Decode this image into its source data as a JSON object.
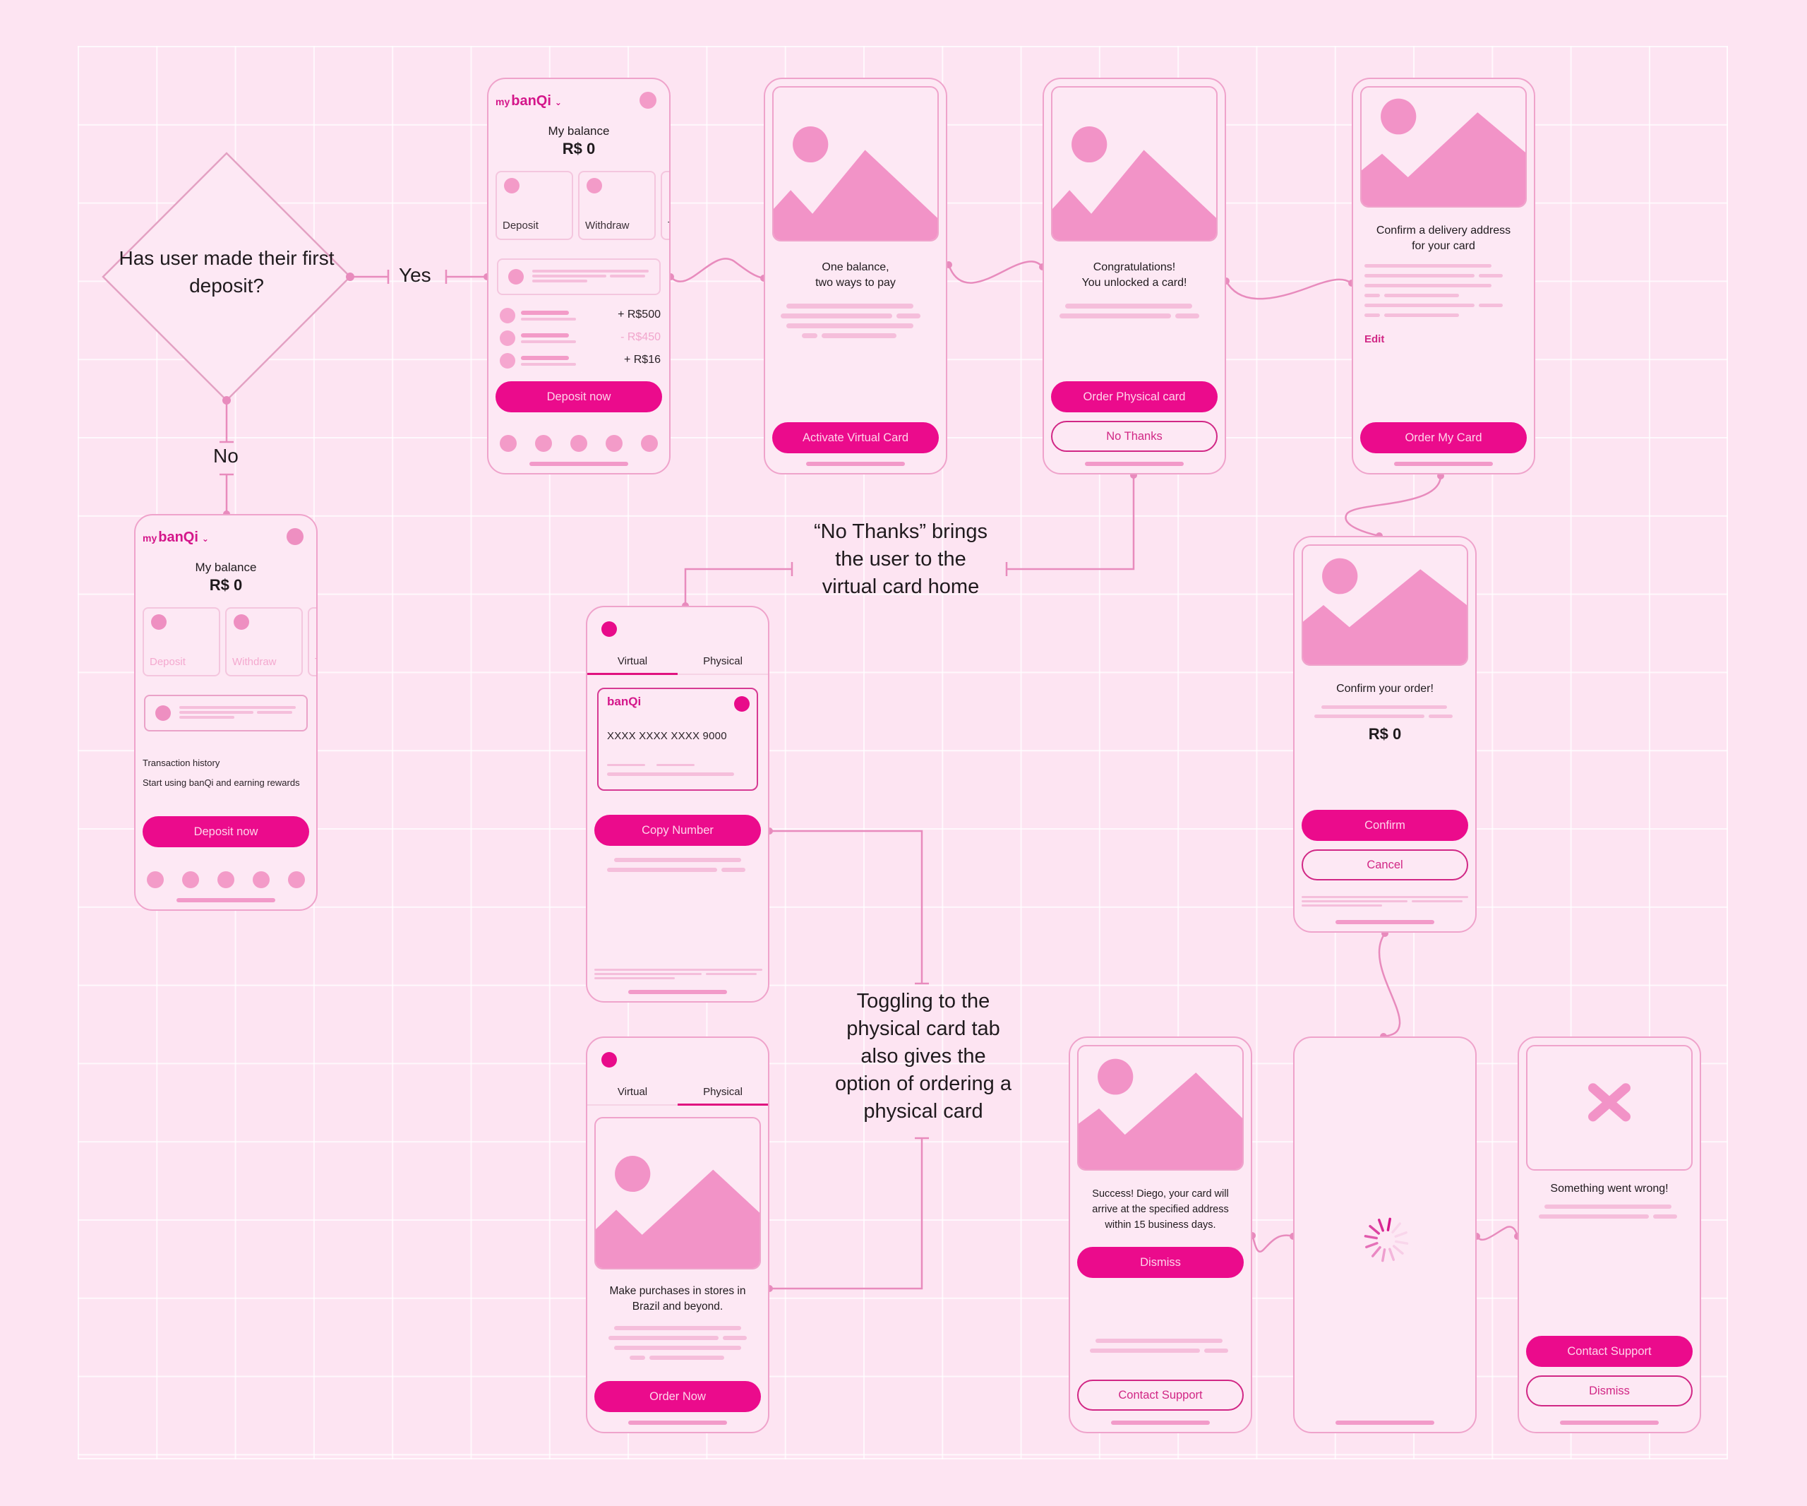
{
  "colors": {
    "background": "#fde4f2",
    "screen_fill": "#fde8f4",
    "primary": "#eb0b8c",
    "primary_text": "#ffd3ea",
    "outline": "#d12785",
    "connector": "#e88bbd",
    "placeholder": "#f5bedb",
    "image_fill": "#f293c7"
  },
  "decision": {
    "question": "Has user made their first deposit?",
    "yes_label": "Yes",
    "no_label": "No"
  },
  "home_with_deposit": {
    "brand_prefix": "my",
    "brand_name": "banQi",
    "balance_label": "My balance",
    "balance_value": "R$ 0",
    "tiles": [
      "Deposit",
      "Withdraw",
      "T"
    ],
    "transactions": [
      {
        "amount": "+ R$500",
        "type": "credit"
      },
      {
        "amount": "- R$450",
        "type": "debit"
      },
      {
        "amount": "+ R$16",
        "type": "credit"
      }
    ],
    "cta": "Deposit now",
    "nav_icons": [
      "home-icon",
      "card-icon",
      "pay-icon",
      "rewards-icon",
      "profile-icon"
    ]
  },
  "home_no_deposit": {
    "brand_prefix": "my",
    "brand_name": "banQi",
    "balance_label": "My balance",
    "balance_value": "R$ 0",
    "tiles": [
      "Deposit",
      "Withdraw",
      "T"
    ],
    "history_title": "Transaction history",
    "history_empty": "Start using banQi and earning rewards",
    "cta": "Deposit now",
    "nav_icons": [
      "home-icon",
      "card-icon",
      "pay-icon",
      "rewards-icon",
      "profile-icon"
    ]
  },
  "intro_screen": {
    "caption": "One balance,\ntwo ways to pay",
    "cta": "Activate Virtual Card"
  },
  "unlock_screen": {
    "caption": "Congratulations!\nYou unlocked a card!",
    "primary_cta": "Order Physical card",
    "secondary_cta": "No Thanks"
  },
  "address_screen": {
    "caption": "Confirm a delivery address\nfor your card",
    "edit_link": "Edit",
    "cta": "Order My Card"
  },
  "confirm_screen": {
    "caption": "Confirm your order!",
    "price": "R$ 0",
    "primary_cta": "Confirm",
    "secondary_cta": "Cancel"
  },
  "virtual_card_screen": {
    "tabs": [
      {
        "label": "Virtual",
        "active": true
      },
      {
        "label": "Physical",
        "active": false
      }
    ],
    "card_brand": "banQi",
    "card_number": "XXXX XXXX XXXX 9000",
    "cta": "Copy Number"
  },
  "physical_tab_screen": {
    "tabs": [
      {
        "label": "Virtual",
        "active": false
      },
      {
        "label": "Physical",
        "active": true
      }
    ],
    "caption": "Make purchases in stores in\nBrazil and beyond.",
    "cta": "Order Now"
  },
  "success_screen": {
    "caption": "Success! Diego, your card will\narrive at the specified address\nwithin 15 business days.",
    "primary_cta": "Dismiss",
    "secondary_cta": "Contact Support"
  },
  "loading_screen": {
    "indicator": "spinner-icon"
  },
  "error_screen": {
    "icon": "close-icon",
    "caption": "Something went wrong!",
    "primary_cta": "Contact Support",
    "secondary_cta": "Dismiss"
  },
  "annotations": {
    "no_thanks": "“No Thanks” brings\nthe user to the\nvirtual card home",
    "toggle": "Toggling to the\nphysical card tab\nalso gives the\noption of ordering a\nphysical card"
  }
}
